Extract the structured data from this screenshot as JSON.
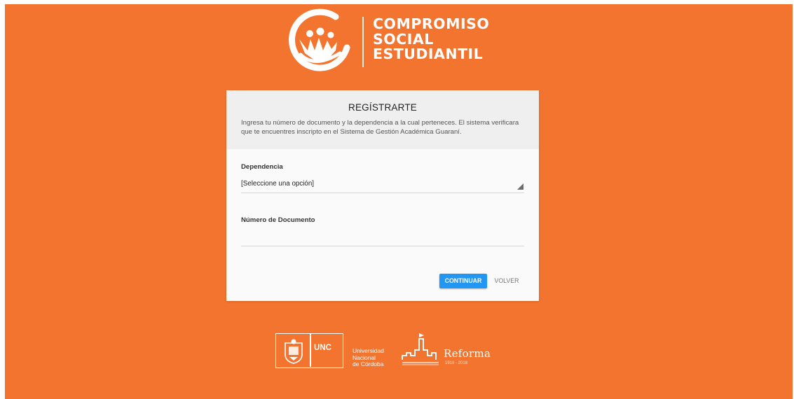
{
  "colors": {
    "page_background": "#f2742f",
    "card_background": "#fafafa",
    "card_header_background": "#efefef",
    "primary_button": "#2196f3"
  },
  "header": {
    "logo_icon": "people-circle-logo-icon",
    "logo_lines": [
      "COMPROMISO",
      "SOCIAL",
      "ESTUDIANTIL"
    ]
  },
  "form": {
    "title": "REGÍSTRARTE",
    "description": "Ingresa tu número de documento y la dependencia a la cual perteneces. El sistema verificara que te encuentres inscripto en el Sistema de Gestión Académica Guaraní.",
    "dependencia": {
      "label": "Dependencia",
      "selected": "[Seleccione una opción]",
      "arrow_icon": "select-arrow-icon"
    },
    "documento": {
      "label": "Número de Documento",
      "value": ""
    },
    "buttons": {
      "continue": "CONTINUAR",
      "back": "VOLVER"
    }
  },
  "footer": {
    "unc_crest_icon": "unc-crest-icon",
    "unc_acronym": "UNC",
    "unc_name_lines": [
      "Universidad",
      "Nacional",
      "de Córdoba"
    ],
    "reforma_icon": "reforma-building-icon",
    "reforma_title": "Reforma",
    "reforma_years": "1918 - 2018"
  }
}
